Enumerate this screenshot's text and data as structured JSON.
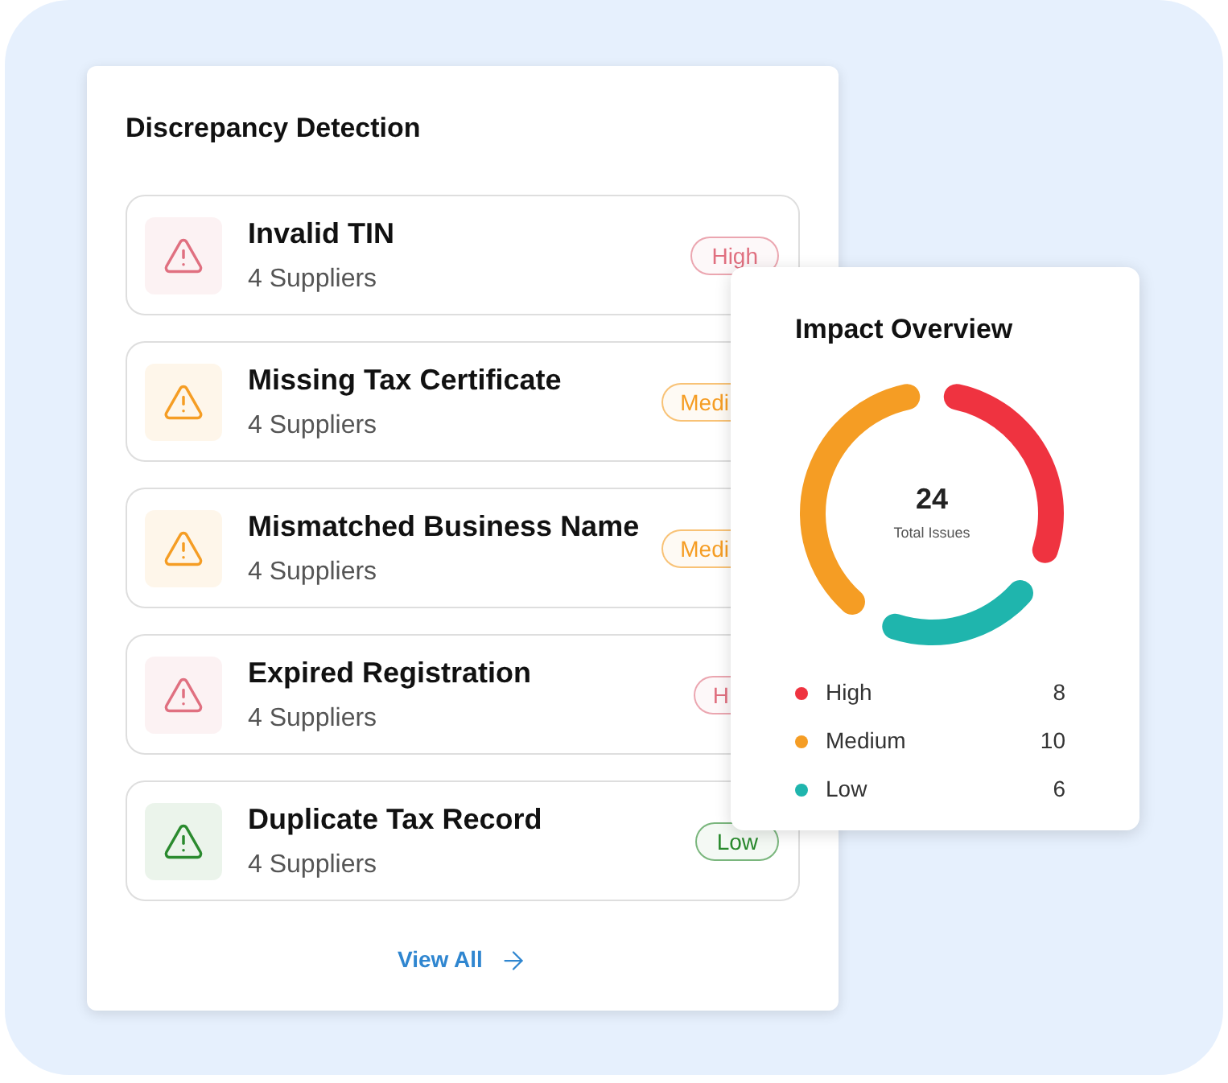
{
  "detection": {
    "title": "Discrepancy Detection",
    "items": [
      {
        "title": "Invalid TIN",
        "subtitle": "4 Suppliers",
        "color": "#e07080",
        "badge": "High",
        "covered": false
      },
      {
        "title": "Missing Tax Certificate",
        "subtitle": "4 Suppliers",
        "color": "#f59d24",
        "badge": "Medi",
        "covered": true
      },
      {
        "title": "Mismatched Business Name",
        "subtitle": "4 Suppliers",
        "color": "#f59d24",
        "badge": "Medi",
        "covered": true
      },
      {
        "title": "Expired Registration",
        "subtitle": "4 Suppliers",
        "color": "#e07080",
        "badge": "H",
        "covered": true
      },
      {
        "title": "Duplicate Tax Record",
        "subtitle": "4 Suppliers",
        "color": "#2a8a2e",
        "badge": "Low",
        "covered": false
      }
    ],
    "link": "View All"
  },
  "impact": {
    "title": "Impact Overview",
    "total": "24",
    "total_label": "Total Issues",
    "chart_data": {
      "type": "donut",
      "categories": [
        "High",
        "Medium",
        "Low"
      ],
      "values": [
        33.33,
        41.67,
        25
      ],
      "colors": [
        "#ef3340",
        "#f59d24",
        "#1fb5ad"
      ],
      "legend": "bottom"
    },
    "counts": [
      "8",
      "10",
      "6"
    ]
  }
}
